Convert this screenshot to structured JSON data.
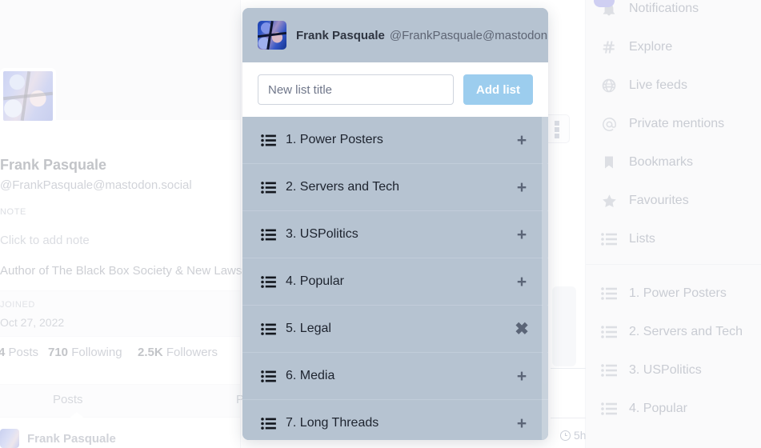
{
  "profile": {
    "name": "Frank Pasquale",
    "handle": "@FrankPasquale@mastodon.social",
    "note_label": "NOTE",
    "note_placeholder": "Click to add note",
    "bio": "Author of The Black Box Society & New Laws of Robo",
    "joined_label": "JOINED",
    "joined_date": "Oct 27, 2022",
    "posts_count": "4",
    "posts_label": "Posts",
    "following_count": "710",
    "following_label": "Following",
    "followers_count": "2.5K",
    "followers_label": "Followers",
    "tab_posts": "Posts",
    "tab_posts_replies": "Po",
    "feed_author": "Frank Pasquale",
    "feed_time": "5h"
  },
  "sidebar": {
    "items": [
      {
        "label": "Notifications",
        "icon": "bell-icon"
      },
      {
        "label": "Explore",
        "icon": "hash-icon"
      },
      {
        "label": "Live feeds",
        "icon": "globe-icon"
      },
      {
        "label": "Private mentions",
        "icon": "at-icon"
      },
      {
        "label": "Bookmarks",
        "icon": "bookmark-icon"
      },
      {
        "label": "Favourites",
        "icon": "star-icon"
      },
      {
        "label": "Lists",
        "icon": "list-icon"
      }
    ],
    "lists": [
      {
        "label": "1. Power Posters",
        "icon": "list-icon"
      },
      {
        "label": "2. Servers and Tech",
        "icon": "list-icon"
      },
      {
        "label": "3. USPolitics",
        "icon": "list-icon"
      },
      {
        "label": "4. Popular",
        "icon": "list-icon"
      }
    ]
  },
  "modal": {
    "account_name": "Frank Pasquale",
    "account_handle": "@FrankPasquale@mastodon.s...",
    "input_placeholder": "New list title",
    "input_value": "",
    "add_button": "Add list",
    "rows": [
      {
        "label": "1. Power Posters",
        "action": "add",
        "action_glyph": "+"
      },
      {
        "label": "2. Servers and Tech",
        "action": "add",
        "action_glyph": "+"
      },
      {
        "label": "3. USPolitics",
        "action": "add",
        "action_glyph": "+"
      },
      {
        "label": "4. Popular",
        "action": "add",
        "action_glyph": "+"
      },
      {
        "label": "5. Legal",
        "action": "remove",
        "action_glyph": "✖"
      },
      {
        "label": "6. Media",
        "action": "add",
        "action_glyph": "+"
      },
      {
        "label": "7. Long Threads",
        "action": "add",
        "action_glyph": "+"
      }
    ]
  },
  "colors": {
    "modal_bg": "#b6c3d1",
    "row_divider": "#c2cdda",
    "add_button": "#9ccdee",
    "badge": "#cfcff2"
  }
}
